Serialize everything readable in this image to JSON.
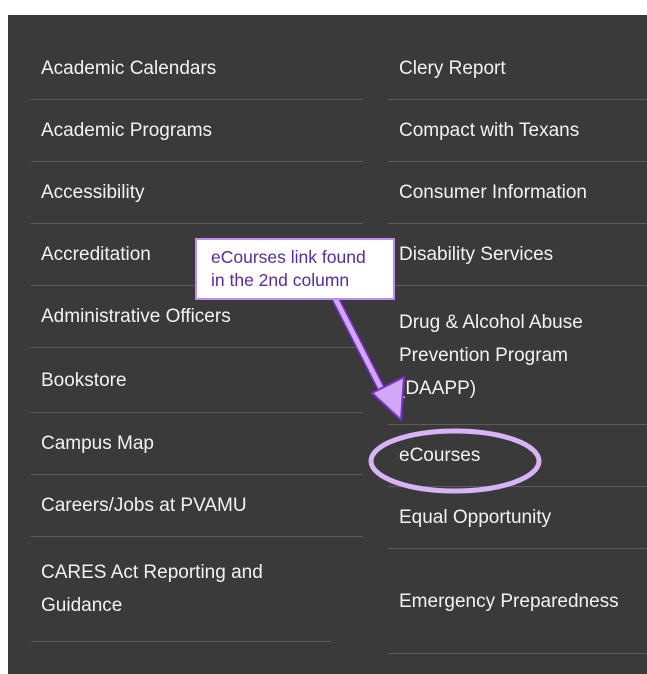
{
  "columns": {
    "left": [
      "Academic Calendars",
      "Academic Programs",
      "Accessibility",
      "Accreditation",
      "Administrative Officers",
      "Bookstore",
      "Campus Map",
      "Careers/Jobs at PVAMU",
      "CARES Act Reporting and Guidance"
    ],
    "right": [
      "Clery Report",
      "Compact with Texans",
      "Consumer Information",
      "Disability Services",
      "Drug & Alcohol Abuse Prevention Program (DAAPP)",
      "eCourses",
      "Equal Opportunity",
      "Emergency Preparedness"
    ]
  },
  "annotation": {
    "callout_line1": "eCourses link found",
    "callout_line2": "in the 2nd column",
    "highlight_target": "eCourses",
    "accent_color": "#c18cf0"
  }
}
